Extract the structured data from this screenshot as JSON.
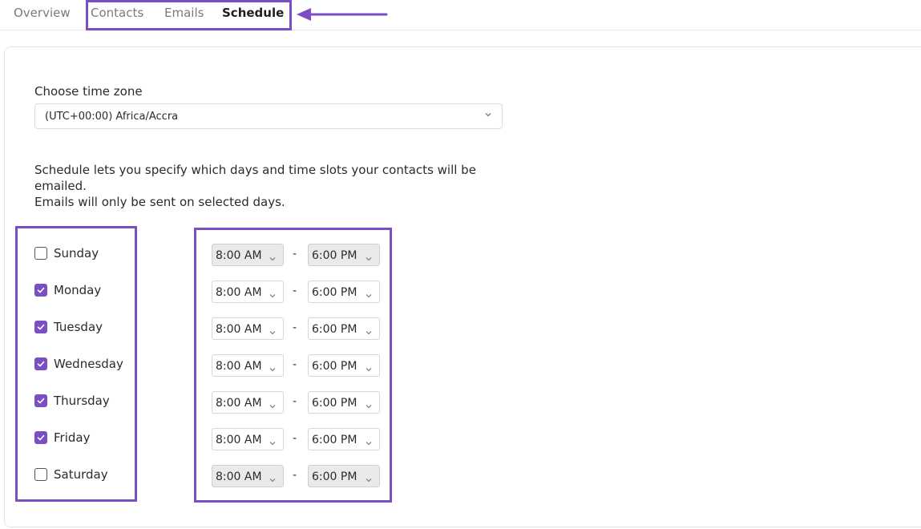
{
  "tabs": [
    {
      "label": "Overview",
      "active": false
    },
    {
      "label": "Contacts",
      "active": false
    },
    {
      "label": "Emails",
      "active": false
    },
    {
      "label": "Schedule",
      "active": true
    }
  ],
  "timezone": {
    "label": "Choose time zone",
    "value": "(UTC+00:00) Africa/Accra"
  },
  "description": {
    "line1": "Schedule lets you specify which days and time slots your contacts will be emailed.",
    "line2": "Emails will only be sent on selected days."
  },
  "days": [
    {
      "label": "Sunday",
      "checked": false,
      "start": "8:00 AM",
      "end": "6:00 PM",
      "disabled": true
    },
    {
      "label": "Monday",
      "checked": true,
      "start": "8:00 AM",
      "end": "6:00 PM",
      "disabled": false
    },
    {
      "label": "Tuesday",
      "checked": true,
      "start": "8:00 AM",
      "end": "6:00 PM",
      "disabled": false
    },
    {
      "label": "Wednesday",
      "checked": true,
      "start": "8:00 AM",
      "end": "6:00 PM",
      "disabled": false
    },
    {
      "label": "Thursday",
      "checked": true,
      "start": "8:00 AM",
      "end": "6:00 PM",
      "disabled": false
    },
    {
      "label": "Friday",
      "checked": true,
      "start": "8:00 AM",
      "end": "6:00 PM",
      "disabled": false
    },
    {
      "label": "Saturday",
      "checked": false,
      "start": "8:00 AM",
      "end": "6:00 PM",
      "disabled": true
    }
  ],
  "separator": "-",
  "colors": {
    "accent": "#7b4fc4",
    "highlight": "#7b4fc4",
    "disabled_bg": "#eaeaea"
  },
  "icons": {
    "dropdown": "chevron-down-icon",
    "checkbox": "check-icon",
    "pointer": "arrow-left-icon"
  }
}
